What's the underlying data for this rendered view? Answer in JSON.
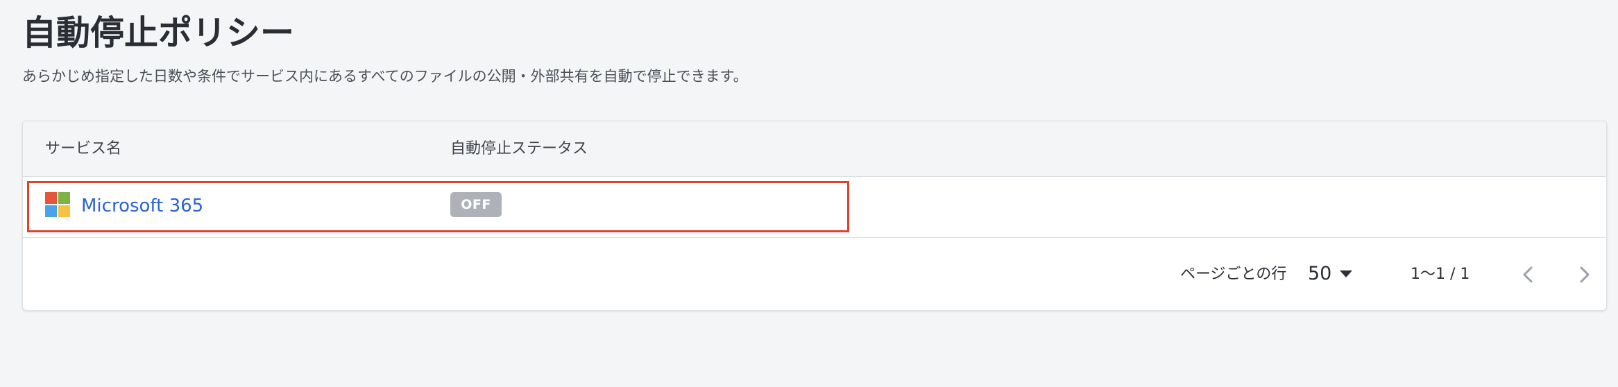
{
  "page": {
    "title": "自動停止ポリシー",
    "description": "あらかじめ指定した日数や条件でサービス内にあるすべてのファイルの公開・外部共有を自動で停止できます。"
  },
  "table": {
    "columns": {
      "service": "サービス名",
      "status": "自動停止ステータス"
    },
    "rows": [
      {
        "service_icon": "microsoft-logo",
        "service_name": "Microsoft 365",
        "status": "OFF"
      }
    ]
  },
  "pagination": {
    "rows_per_page_label": "ページごとの行",
    "rows_per_page_value": "50",
    "range": "1〜1 / 1",
    "prev_icon": "chevron-left-icon",
    "next_icon": "chevron-right-icon"
  },
  "colors": {
    "link": "#2b63d1",
    "highlight_border": "#e0422c",
    "badge_off": "#aeb2b8",
    "ms_red": "#f25022",
    "ms_green": "#7fba00",
    "ms_blue": "#00a4ef",
    "ms_yellow": "#ffb900"
  }
}
